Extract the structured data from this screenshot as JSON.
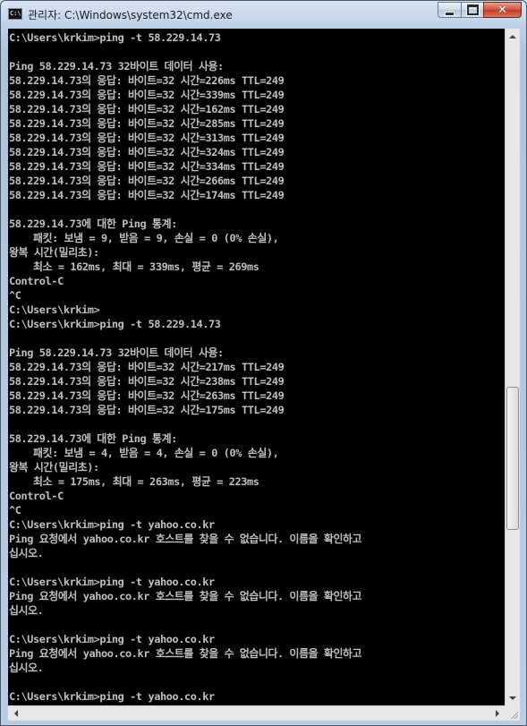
{
  "window": {
    "title": "관리자: C:\\Windows\\system32\\cmd.exe",
    "icon_text": "C:\\",
    "close_symbol": "✕"
  },
  "console": {
    "lines": [
      "C:\\Users\\krkim>ping -t 58.229.14.73",
      "",
      "Ping 58.229.14.73 32바이트 데이터 사용:",
      "58.229.14.73의 응답: 바이트=32 시간=226ms TTL=249",
      "58.229.14.73의 응답: 바이트=32 시간=339ms TTL=249",
      "58.229.14.73의 응답: 바이트=32 시간=162ms TTL=249",
      "58.229.14.73의 응답: 바이트=32 시간=285ms TTL=249",
      "58.229.14.73의 응답: 바이트=32 시간=313ms TTL=249",
      "58.229.14.73의 응답: 바이트=32 시간=324ms TTL=249",
      "58.229.14.73의 응답: 바이트=32 시간=334ms TTL=249",
      "58.229.14.73의 응답: 바이트=32 시간=266ms TTL=249",
      "58.229.14.73의 응답: 바이트=32 시간=174ms TTL=249",
      "",
      "58.229.14.73에 대한 Ping 통계:",
      "    패킷: 보냄 = 9, 받음 = 9, 손실 = 0 (0% 손실),",
      "왕복 시간(밀리초):",
      "    최소 = 162ms, 최대 = 339ms, 평균 = 269ms",
      "Control-C",
      "^C",
      "C:\\Users\\krkim>",
      "C:\\Users\\krkim>ping -t 58.229.14.73",
      "",
      "Ping 58.229.14.73 32바이트 데이터 사용:",
      "58.229.14.73의 응답: 바이트=32 시간=217ms TTL=249",
      "58.229.14.73의 응답: 바이트=32 시간=238ms TTL=249",
      "58.229.14.73의 응답: 바이트=32 시간=263ms TTL=249",
      "58.229.14.73의 응답: 바이트=32 시간=175ms TTL=249",
      "",
      "58.229.14.73에 대한 Ping 통계:",
      "    패킷: 보냄 = 4, 받음 = 4, 손실 = 0 (0% 손실),",
      "왕복 시간(밀리초):",
      "    최소 = 175ms, 최대 = 263ms, 평균 = 223ms",
      "Control-C",
      "^C",
      "C:\\Users\\krkim>ping -t yahoo.co.kr",
      "Ping 요청에서 yahoo.co.kr 호스트를 찾을 수 없습니다. 이름을 확인하고",
      "십시오.",
      "",
      "C:\\Users\\krkim>ping -t yahoo.co.kr",
      "Ping 요청에서 yahoo.co.kr 호스트를 찾을 수 없습니다. 이름을 확인하고",
      "십시오.",
      "",
      "C:\\Users\\krkim>ping -t yahoo.co.kr",
      "Ping 요청에서 yahoo.co.kr 호스트를 찾을 수 없습니다. 이름을 확인하고",
      "십시오.",
      "",
      "C:\\Users\\krkim>ping -t yahoo.co.kr"
    ]
  },
  "colors": {
    "console_background": "#000000",
    "console_text": "#c0c0c0"
  }
}
